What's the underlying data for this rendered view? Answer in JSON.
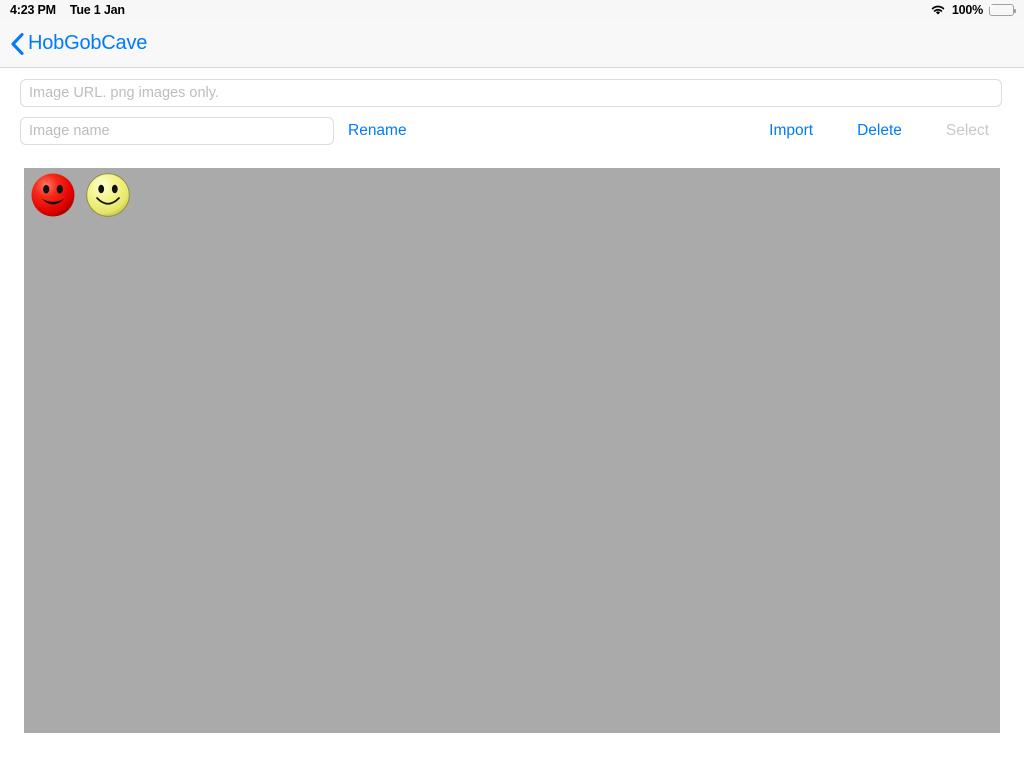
{
  "status_bar": {
    "time": "4:23 PM",
    "date": "Tue 1 Jan",
    "wifi_icon": "wifi-icon",
    "battery_percent": "100%",
    "battery_icon": "battery-charging-icon",
    "battery_color": "#32d74b"
  },
  "nav_bar": {
    "back_icon": "chevron-left-icon",
    "back_label": "HobGobCave",
    "tint_color": "#007aff"
  },
  "form": {
    "url_field": {
      "value": "",
      "placeholder": "Image URL. png images only."
    },
    "name_field": {
      "value": "",
      "placeholder": "Image name"
    },
    "rename_label": "Rename"
  },
  "toolbar": {
    "import_label": "Import",
    "delete_label": "Delete",
    "select_label": "Select",
    "select_disabled": true
  },
  "gallery": {
    "background_color": "#aaaaaa",
    "thumbnails": [
      {
        "name": "red-smiley-face",
        "face_color": "#ee1111",
        "highlight_color": "#ff8a80",
        "shadow_color": "#a10000",
        "mouth_style": "filled"
      },
      {
        "name": "yellow-smiley-face",
        "face_color": "#efef77",
        "highlight_color": "#ffffc8",
        "shadow_color": "#b5b54a",
        "mouth_style": "outline"
      }
    ]
  }
}
